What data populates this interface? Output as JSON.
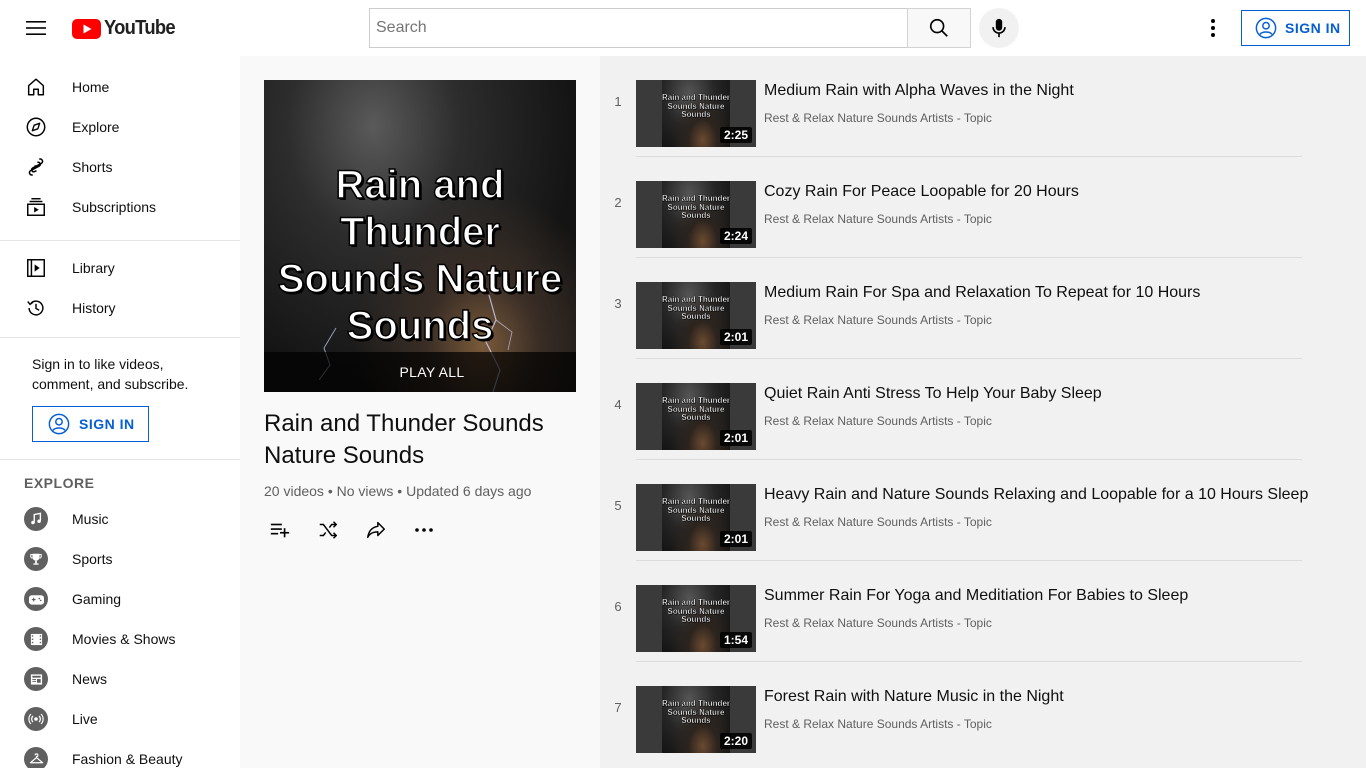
{
  "header": {
    "logo_text": "YouTube",
    "search_placeholder": "Search",
    "sign_in_label": "SIGN IN",
    "brand_red": "#ff0000",
    "accent_blue": "#065fd4"
  },
  "sidebar": {
    "main": [
      {
        "label": "Home",
        "icon": "home-icon"
      },
      {
        "label": "Explore",
        "icon": "compass-icon"
      },
      {
        "label": "Shorts",
        "icon": "shorts-icon"
      },
      {
        "label": "Subscriptions",
        "icon": "subscriptions-icon"
      }
    ],
    "library": [
      {
        "label": "Library",
        "icon": "library-icon"
      },
      {
        "label": "History",
        "icon": "history-icon"
      }
    ],
    "signin_prompt": "Sign in to like videos, comment, and subscribe.",
    "sign_in_label": "SIGN IN",
    "explore_header": "EXPLORE",
    "explore": [
      {
        "label": "Music",
        "icon": "music-icon"
      },
      {
        "label": "Sports",
        "icon": "trophy-icon"
      },
      {
        "label": "Gaming",
        "icon": "gaming-icon"
      },
      {
        "label": "Movies & Shows",
        "icon": "film-icon"
      },
      {
        "label": "News",
        "icon": "news-icon"
      },
      {
        "label": "Live",
        "icon": "live-icon"
      },
      {
        "label": "Fashion & Beauty",
        "icon": "hanger-icon"
      }
    ]
  },
  "playlist": {
    "thumbnail_text": "Rain and Thunder Sounds Nature Sounds",
    "play_all_label": "PLAY ALL",
    "title": "Rain and Thunder Sounds Nature Sounds",
    "stats": "20 videos • No views • Updated 6 days ago",
    "actions": [
      "add-to-queue-icon",
      "shuffle-icon",
      "share-icon",
      "more-icon"
    ]
  },
  "videos": [
    {
      "index": "1",
      "title": "Medium Rain with Alpha Waves in the Night",
      "channel": "Rest & Relax Nature Sounds Artists - Topic",
      "duration": "2:25",
      "thumb_text": "Rain and Thunder Sounds Nature Sounds"
    },
    {
      "index": "2",
      "title": "Cozy Rain For Peace Loopable for 20 Hours",
      "channel": "Rest & Relax Nature Sounds Artists - Topic",
      "duration": "2:24",
      "thumb_text": "Rain and Thunder Sounds Nature Sounds"
    },
    {
      "index": "3",
      "title": "Medium Rain For Spa and Relaxation To Repeat for 10 Hours",
      "channel": "Rest & Relax Nature Sounds Artists - Topic",
      "duration": "2:01",
      "thumb_text": "Rain and Thunder Sounds Nature Sounds"
    },
    {
      "index": "4",
      "title": "Quiet Rain Anti Stress To Help Your Baby Sleep",
      "channel": "Rest & Relax Nature Sounds Artists - Topic",
      "duration": "2:01",
      "thumb_text": "Rain and Thunder Sounds Nature Sounds"
    },
    {
      "index": "5",
      "title": "Heavy Rain and Nature Sounds Relaxing and Loopable for a 10 Hours Sleep",
      "channel": "Rest & Relax Nature Sounds Artists - Topic",
      "duration": "2:01",
      "thumb_text": "Rain and Thunder Sounds Nature Sounds"
    },
    {
      "index": "6",
      "title": "Summer Rain For Yoga and Meditiation For Babies to Sleep",
      "channel": "Rest & Relax Nature Sounds Artists - Topic",
      "duration": "1:54",
      "thumb_text": "Rain and Thunder Sounds Nature Sounds"
    },
    {
      "index": "7",
      "title": "Forest Rain with Nature Music in the Night",
      "channel": "Rest & Relax Nature Sounds Artists - Topic",
      "duration": "2:20",
      "thumb_text": "Rain and Thunder Sounds Nature Sounds"
    }
  ]
}
